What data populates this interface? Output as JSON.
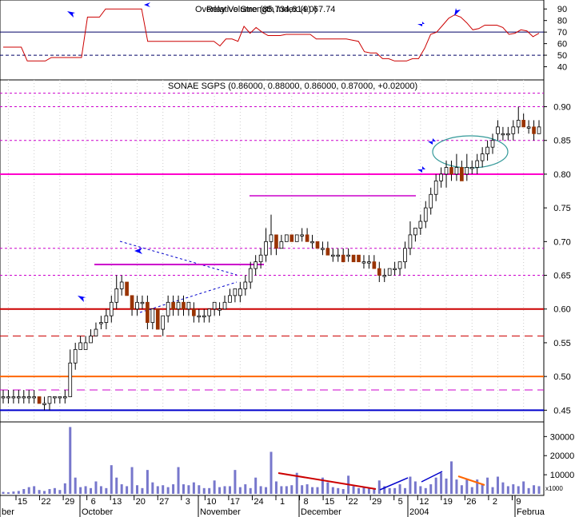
{
  "chart_data": [
    {
      "panel": "rsi",
      "type": "line",
      "title": "Relative Strength Index (9) 67.74",
      "overlay_title": "Overlay Volume (85,734,814.0)",
      "yticks": [
        "40",
        "50",
        "60",
        "70",
        "80",
        "90"
      ],
      "ylim": [
        30,
        95
      ],
      "reference_levels": [
        70,
        50
      ],
      "values": [
        57,
        57,
        57,
        57,
        45,
        45,
        45,
        45,
        48,
        48,
        48,
        48,
        48,
        48,
        83,
        83,
        83,
        90,
        90,
        90,
        90,
        90,
        90,
        90,
        62,
        62,
        62,
        62,
        62,
        62,
        62,
        62,
        62,
        62,
        62,
        62,
        58,
        64,
        64,
        62,
        75,
        69,
        74,
        70,
        67,
        67,
        67,
        68,
        68,
        68,
        68,
        68,
        64,
        64,
        64,
        64,
        64,
        64,
        63,
        62,
        53,
        52,
        52,
        47,
        47,
        45,
        45,
        45,
        47,
        47,
        56,
        68,
        70,
        76,
        82,
        85,
        83,
        78,
        72,
        73,
        76,
        76,
        76,
        74,
        68,
        69,
        72,
        71,
        66,
        69
      ]
    },
    {
      "panel": "price",
      "type": "candlestick",
      "title": "SONAE SGPS (0.86000, 0.88000, 0.86000, 0.87000, +0.02000)",
      "yticks": [
        "0.45",
        "0.50",
        "0.55",
        "0.60",
        "0.65",
        "0.70",
        "0.75",
        "0.80",
        "0.85",
        "0.90"
      ],
      "ylim": [
        0.435,
        0.935
      ],
      "candles": [
        [
          0.47,
          0.48,
          0.46,
          0.47
        ],
        [
          0.47,
          0.48,
          0.46,
          0.47
        ],
        [
          0.47,
          0.48,
          0.46,
          0.47
        ],
        [
          0.47,
          0.48,
          0.46,
          0.47
        ],
        [
          0.47,
          0.48,
          0.46,
          0.47
        ],
        [
          0.47,
          0.48,
          0.46,
          0.47
        ],
        [
          0.47,
          0.48,
          0.46,
          0.47
        ],
        [
          0.47,
          0.47,
          0.46,
          0.46
        ],
        [
          0.46,
          0.47,
          0.45,
          0.46
        ],
        [
          0.46,
          0.47,
          0.45,
          0.47
        ],
        [
          0.47,
          0.47,
          0.46,
          0.47
        ],
        [
          0.47,
          0.47,
          0.46,
          0.47
        ],
        [
          0.47,
          0.48,
          0.46,
          0.47
        ],
        [
          0.47,
          0.54,
          0.47,
          0.52
        ],
        [
          0.52,
          0.55,
          0.51,
          0.54
        ],
        [
          0.54,
          0.56,
          0.54,
          0.55
        ],
        [
          0.54,
          0.56,
          0.54,
          0.55
        ],
        [
          0.55,
          0.57,
          0.55,
          0.56
        ],
        [
          0.56,
          0.58,
          0.56,
          0.57
        ],
        [
          0.58,
          0.59,
          0.57,
          0.58
        ],
        [
          0.58,
          0.6,
          0.57,
          0.59
        ],
        [
          0.59,
          0.62,
          0.58,
          0.61
        ],
        [
          0.61,
          0.65,
          0.6,
          0.63
        ],
        [
          0.63,
          0.65,
          0.62,
          0.64
        ],
        [
          0.64,
          0.64,
          0.62,
          0.62
        ],
        [
          0.62,
          0.62,
          0.59,
          0.6
        ],
        [
          0.6,
          0.62,
          0.59,
          0.61
        ],
        [
          0.61,
          0.62,
          0.6,
          0.61
        ],
        [
          0.61,
          0.62,
          0.57,
          0.58
        ],
        [
          0.58,
          0.6,
          0.57,
          0.6
        ],
        [
          0.6,
          0.6,
          0.57,
          0.57
        ],
        [
          0.57,
          0.59,
          0.56,
          0.59
        ],
        [
          0.59,
          0.62,
          0.58,
          0.61
        ],
        [
          0.61,
          0.62,
          0.59,
          0.6
        ],
        [
          0.6,
          0.62,
          0.59,
          0.61
        ],
        [
          0.61,
          0.62,
          0.59,
          0.6
        ],
        [
          0.6,
          0.61,
          0.59,
          0.61
        ],
        [
          0.6,
          0.61,
          0.58,
          0.59
        ],
        [
          0.59,
          0.6,
          0.58,
          0.59
        ],
        [
          0.59,
          0.6,
          0.58,
          0.59
        ],
        [
          0.59,
          0.6,
          0.58,
          0.6
        ],
        [
          0.6,
          0.61,
          0.59,
          0.61
        ],
        [
          0.6,
          0.61,
          0.59,
          0.6
        ],
        [
          0.6,
          0.62,
          0.6,
          0.61
        ],
        [
          0.61,
          0.63,
          0.61,
          0.62
        ],
        [
          0.62,
          0.63,
          0.61,
          0.63
        ],
        [
          0.62,
          0.64,
          0.61,
          0.63
        ],
        [
          0.63,
          0.65,
          0.62,
          0.64
        ],
        [
          0.64,
          0.67,
          0.63,
          0.66
        ],
        [
          0.66,
          0.68,
          0.65,
          0.67
        ],
        [
          0.67,
          0.69,
          0.66,
          0.68
        ],
        [
          0.68,
          0.72,
          0.67,
          0.7
        ],
        [
          0.7,
          0.74,
          0.68,
          0.71
        ],
        [
          0.71,
          0.71,
          0.68,
          0.69
        ],
        [
          0.69,
          0.71,
          0.69,
          0.7
        ],
        [
          0.7,
          0.71,
          0.7,
          0.71
        ],
        [
          0.71,
          0.71,
          0.7,
          0.7
        ],
        [
          0.7,
          0.71,
          0.7,
          0.71
        ],
        [
          0.71,
          0.72,
          0.7,
          0.71
        ],
        [
          0.71,
          0.72,
          0.7,
          0.7
        ],
        [
          0.7,
          0.71,
          0.69,
          0.7
        ],
        [
          0.7,
          0.7,
          0.69,
          0.69
        ],
        [
          0.69,
          0.7,
          0.68,
          0.69
        ],
        [
          0.69,
          0.7,
          0.68,
          0.68
        ],
        [
          0.68,
          0.69,
          0.67,
          0.68
        ],
        [
          0.68,
          0.69,
          0.67,
          0.68
        ],
        [
          0.68,
          0.69,
          0.67,
          0.67
        ],
        [
          0.68,
          0.69,
          0.67,
          0.68
        ],
        [
          0.68,
          0.68,
          0.67,
          0.67
        ],
        [
          0.68,
          0.68,
          0.67,
          0.67
        ],
        [
          0.67,
          0.68,
          0.66,
          0.67
        ],
        [
          0.67,
          0.68,
          0.66,
          0.67
        ],
        [
          0.67,
          0.68,
          0.66,
          0.66
        ],
        [
          0.66,
          0.67,
          0.64,
          0.65
        ],
        [
          0.65,
          0.66,
          0.64,
          0.65
        ],
        [
          0.65,
          0.66,
          0.65,
          0.66
        ],
        [
          0.66,
          0.67,
          0.65,
          0.66
        ],
        [
          0.66,
          0.67,
          0.65,
          0.67
        ],
        [
          0.67,
          0.7,
          0.66,
          0.69
        ],
        [
          0.69,
          0.73,
          0.68,
          0.71
        ],
        [
          0.71,
          0.72,
          0.7,
          0.72
        ],
        [
          0.72,
          0.74,
          0.71,
          0.73
        ],
        [
          0.73,
          0.76,
          0.72,
          0.75
        ],
        [
          0.75,
          0.78,
          0.74,
          0.77
        ],
        [
          0.77,
          0.8,
          0.76,
          0.79
        ],
        [
          0.79,
          0.81,
          0.78,
          0.8
        ],
        [
          0.8,
          0.82,
          0.78,
          0.81
        ],
        [
          0.81,
          0.82,
          0.79,
          0.8
        ],
        [
          0.8,
          0.83,
          0.79,
          0.81
        ],
        [
          0.81,
          0.82,
          0.79,
          0.79
        ],
        [
          0.8,
          0.83,
          0.79,
          0.81
        ],
        [
          0.81,
          0.82,
          0.8,
          0.81
        ],
        [
          0.81,
          0.83,
          0.8,
          0.82
        ],
        [
          0.82,
          0.84,
          0.81,
          0.83
        ],
        [
          0.83,
          0.85,
          0.82,
          0.84
        ],
        [
          0.84,
          0.86,
          0.83,
          0.85
        ],
        [
          0.86,
          0.88,
          0.85,
          0.87
        ],
        [
          0.86,
          0.87,
          0.85,
          0.86
        ],
        [
          0.86,
          0.87,
          0.85,
          0.86
        ],
        [
          0.86,
          0.88,
          0.85,
          0.87
        ],
        [
          0.87,
          0.9,
          0.86,
          0.88
        ],
        [
          0.88,
          0.89,
          0.87,
          0.87
        ],
        [
          0.87,
          0.88,
          0.86,
          0.87
        ],
        [
          0.87,
          0.88,
          0.85,
          0.86
        ],
        [
          0.86,
          0.88,
          0.86,
          0.87
        ]
      ],
      "horizontal_levels": [
        {
          "value": 0.45,
          "color": "#0000cc"
        },
        {
          "value": 0.5,
          "color": "#ff6600"
        },
        {
          "value": 0.48,
          "color": "#cc00cc",
          "style": "dashed"
        },
        {
          "value": 0.56,
          "color": "#cc0000",
          "style": "dashed"
        },
        {
          "value": 0.6,
          "color": "#cc0000"
        },
        {
          "value": 0.65,
          "color": "#cc00cc",
          "style": "dotted"
        },
        {
          "value": 0.69,
          "color": "#cc00cc",
          "style": "dotted"
        },
        {
          "value": 0.8,
          "color": "#ff00cc"
        },
        {
          "value": 0.85,
          "color": "#cc00cc",
          "style": "dotted"
        },
        {
          "value": 0.9,
          "color": "#cc00cc",
          "style": "dotted"
        },
        {
          "value": 0.92,
          "color": "#cc00cc",
          "style": "dotted"
        }
      ]
    },
    {
      "panel": "volume",
      "type": "bar",
      "yticks": [
        "30000",
        "20000",
        "10000"
      ],
      "unit_label": "x1000",
      "ylim": [
        0,
        36000
      ],
      "values": [
        1000,
        800,
        1200,
        1500,
        2500,
        3500,
        4000,
        2000,
        1500,
        2500,
        3000,
        2000,
        5500,
        35000,
        8500,
        3500,
        4000,
        3000,
        6500,
        4000,
        3000,
        15000,
        8500,
        5000,
        4000,
        14000,
        4500,
        3000,
        12500,
        6000,
        4000,
        4500,
        3500,
        5000,
        14000,
        5000,
        4500,
        6000,
        4500,
        3000,
        3000,
        7000,
        3500,
        4000,
        4000,
        12500,
        3500,
        5000,
        3000,
        8500,
        4000,
        3500,
        22000,
        6500,
        4000,
        4000,
        4500,
        11000,
        4500,
        5000,
        3500,
        3500,
        8500,
        6000,
        3500,
        3000,
        2500,
        9500,
        4000,
        3000,
        3500,
        3000,
        3000,
        7000,
        4000,
        3000,
        3000,
        5000,
        3000,
        9000,
        6500,
        4000,
        3000,
        5000,
        8500,
        11000,
        8000,
        17000,
        7500,
        4500,
        7500,
        3500,
        7500,
        5000,
        8500,
        3500,
        9000,
        6000,
        4000,
        5000,
        4000,
        6500,
        3000,
        4500,
        4000
      ],
      "trendlines": [
        {
          "color": "#cc0000"
        },
        {
          "color": "#0000cc"
        },
        {
          "color": "#0000cc"
        },
        {
          "color": "#ff6600"
        }
      ]
    }
  ],
  "x_axis": {
    "day_labels": [
      "15",
      "22",
      "29",
      "6",
      "13",
      "20",
      "27",
      "3",
      "10",
      "17",
      "24",
      "1",
      "8",
      "15",
      "22",
      "29",
      "5",
      "12",
      "19",
      "26",
      "2",
      "9"
    ],
    "month_labels": [
      "ber",
      "October",
      "November",
      "December",
      "2004",
      "Februa"
    ]
  },
  "colors": {
    "up_candle": "#0000cc",
    "down_candle": "#993300",
    "rsi_line": "#cc0000",
    "volume_bar": "#7777cc",
    "arrow": "#0000ff",
    "axis": "#000000",
    "background": "#ffffff"
  }
}
